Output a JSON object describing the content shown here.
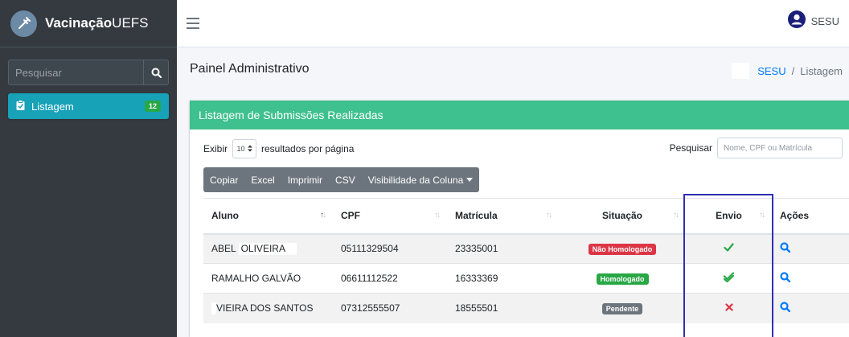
{
  "brand": {
    "name_bold": "Vacinação",
    "name_light": "UEFS"
  },
  "sidebar": {
    "search_placeholder": "Pesquisar",
    "items": [
      {
        "label": "Listagem",
        "badge": "12"
      }
    ]
  },
  "topnav": {
    "user_name": "SESU"
  },
  "header": {
    "title": "Painel Administrativo",
    "breadcrumb": {
      "link": "SESU",
      "separator": "/",
      "current": "Listagem"
    }
  },
  "card": {
    "title": "Listagem de Submissões Realizadas",
    "length": {
      "prefix": "Exibir",
      "value": "10",
      "suffix": "resultados por página"
    },
    "search": {
      "label": "Pesquisar",
      "placeholder": "Nome, CPF ou Matrícula"
    },
    "buttons": {
      "copy": "Copiar",
      "excel": "Excel",
      "print": "Imprimir",
      "csv": "CSV",
      "colvis": "Visibilidade da Coluna"
    }
  },
  "table": {
    "columns": [
      "Aluno",
      "CPF",
      "Matrícula",
      "Situação",
      "Envio",
      "Ações"
    ],
    "rows": [
      {
        "aluno_first": "ABEL",
        "aluno_last": "OLIVEIRA",
        "cpf": "05111329504",
        "matricula": "23335001",
        "situacao": "Não Homologado",
        "envio_icon": "check-icon"
      },
      {
        "aluno": "RAMALHO GALVÃO",
        "cpf": "06611112522",
        "matricula": "16333369",
        "situacao": "Homologado",
        "envio_icon": "double-check-icon"
      },
      {
        "aluno": "VIEIRA DOS SANTOS",
        "cpf": "07312555507",
        "matricula": "18555501",
        "situacao": "Pendente",
        "envio_icon": "x-icon"
      }
    ]
  },
  "colors": {
    "card_header": "#3fc08f",
    "nav_active": "#17a2b8",
    "danger": "#dc3545",
    "success": "#28a745",
    "secondary": "#6c757d",
    "primary": "#007bff",
    "highlight": "#2f2fb5"
  }
}
